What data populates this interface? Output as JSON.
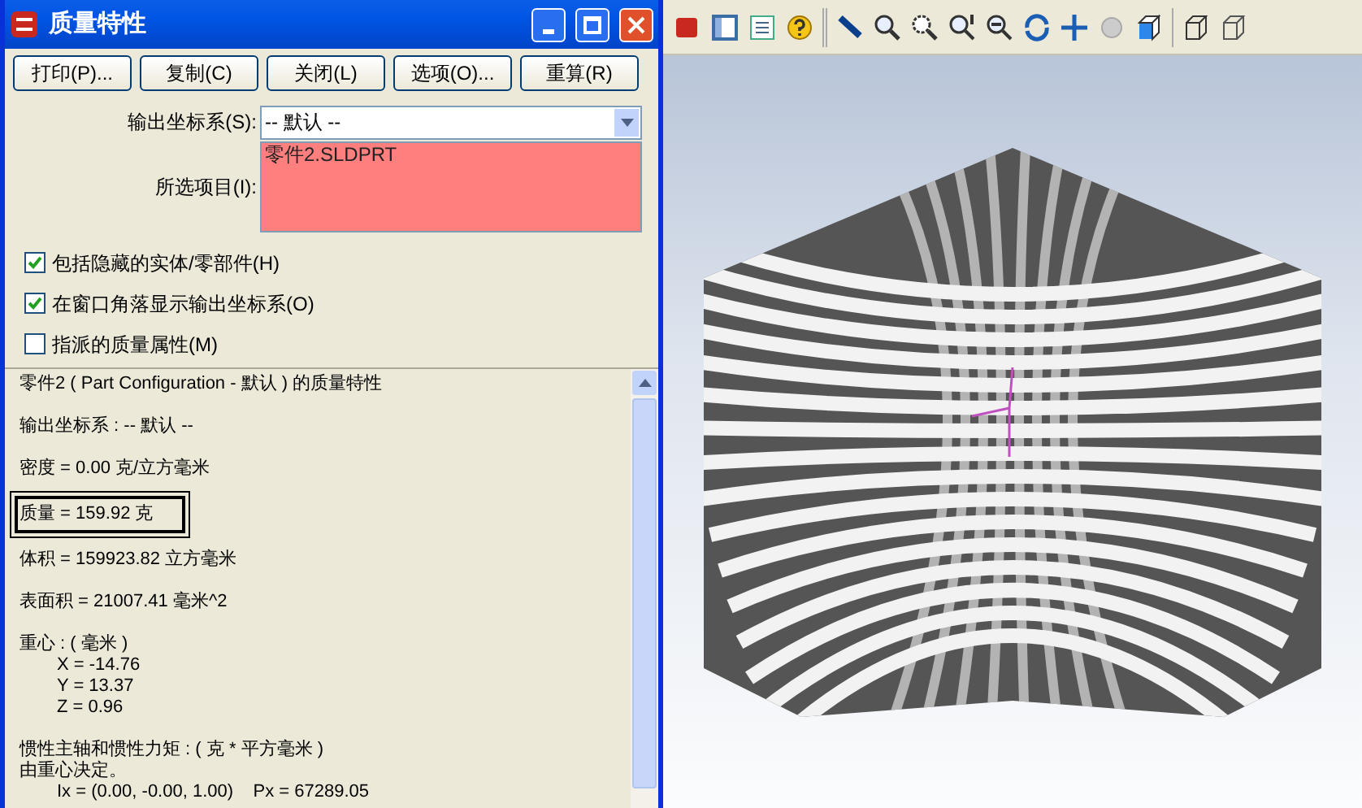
{
  "window": {
    "title": "质量特性"
  },
  "buttons": [
    "打印(P)...",
    "复制(C)",
    "关闭(L)",
    "选项(O)...",
    "重算(R)"
  ],
  "output_coordinate": {
    "label": "输出坐标系(S):",
    "value": "-- 默认 --"
  },
  "selected_items": {
    "label": "所选项目(I):",
    "items": [
      "零件2.SLDPRT"
    ]
  },
  "checkboxes": [
    {
      "label": "包括隐藏的实体/零部件(H)",
      "checked": true
    },
    {
      "label": "在窗口角落显示输出坐标系(O)",
      "checked": true
    },
    {
      "label": "指派的质量属性(M)",
      "checked": false
    }
  ],
  "results": [
    {
      "boxed": false,
      "lines": [
        {
          "kind": "text",
          "text": "零件2 ( Part Configuration - 默认 ) 的质量特性"
        }
      ]
    },
    {
      "boxed": false,
      "lines": [
        {
          "kind": "text",
          "text": "输出坐标系 : -- 默认 --"
        }
      ]
    },
    {
      "boxed": false,
      "lines": [
        {
          "kind": "text",
          "text": "密度 = 0.00 克/立方毫米"
        }
      ]
    },
    {
      "boxed": true,
      "lines": [
        {
          "kind": "text",
          "text": "质量 = 159.92 克"
        }
      ]
    },
    {
      "boxed": false,
      "lines": [
        {
          "kind": "text",
          "text": "体积 = 159923.82 立方毫米"
        }
      ]
    },
    {
      "boxed": false,
      "lines": [
        {
          "kind": "text",
          "text": "表面积 = 21007.41 毫米^2"
        }
      ]
    },
    {
      "boxed": false,
      "lines": [
        {
          "kind": "text",
          "text": "重心 : ( 毫米 )"
        },
        {
          "kind": "indented",
          "text": "X = -14.76"
        },
        {
          "kind": "indented",
          "text": "Y = 13.37"
        },
        {
          "kind": "indented",
          "text": "Z = 0.96"
        }
      ]
    },
    {
      "boxed": false,
      "lines": [
        {
          "kind": "text",
          "text": "惯性主轴和惯性力矩 : ( 克 * 平方毫米 )"
        },
        {
          "kind": "text",
          "text": "由重心决定。"
        },
        {
          "kind": "indented",
          "text": "Ix = (0.00, -0.00, 1.00)    Px = 67289.05"
        }
      ]
    }
  ]
}
